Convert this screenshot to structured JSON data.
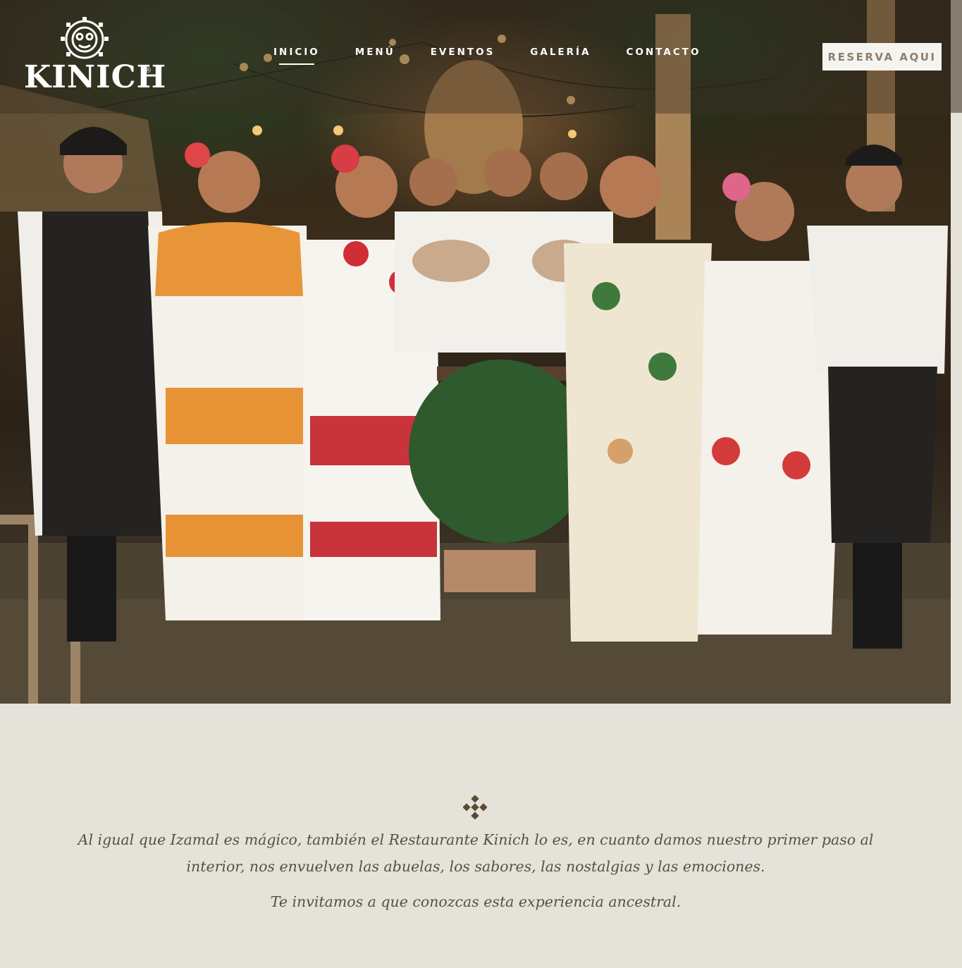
{
  "brand": {
    "name": "KINICH",
    "registered_mark": "®"
  },
  "nav": {
    "items": [
      {
        "label": "INICIO",
        "active": true
      },
      {
        "label": "MENÚ",
        "active": false
      },
      {
        "label": "EVENTOS",
        "active": false
      },
      {
        "label": "GALERÍA",
        "active": false
      },
      {
        "label": "CONTACTO",
        "active": false
      }
    ]
  },
  "header": {
    "reserve_label": "RESERVA AQUI"
  },
  "intro": {
    "paragraph_1": "Al igual que Izamal es mágico, también el Restaurante Kinich lo es, en cuanto damos nuestro primer paso al interior, nos envuelven las abuelas, los sabores, las nostalgias y las emociones.",
    "paragraph_2": "Te invitamos a que conozcas esta experiencia ancestral."
  },
  "colors": {
    "page_background": "#e5e2da",
    "text_brown": "#5a5040",
    "reserve_text": "#8d7f6e",
    "ornament": "#5b4a32"
  },
  "icons": {
    "logo_emblem": "sun-glyph-icon",
    "ornament": "diamond-ornament-icon"
  }
}
